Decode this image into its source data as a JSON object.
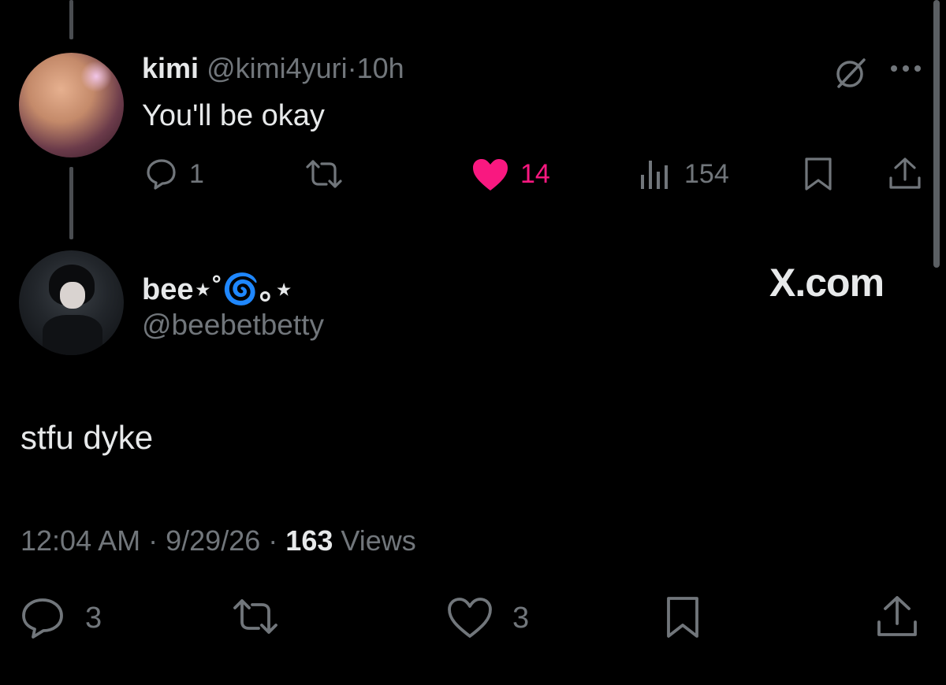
{
  "reply_tweet": {
    "display_name": "kimi",
    "handle": "@kimi4yuri",
    "separator": "·",
    "time": "10h",
    "text": "You'll be okay",
    "replies": "1",
    "likes": "14",
    "views": "154",
    "like_color": "#f91880"
  },
  "main_tweet": {
    "display_name": "bee⋆˚🌀｡⋆",
    "handle": "@beebetbetty",
    "text": "stfu dyke",
    "time": "12:04 AM",
    "date": "9/29/26",
    "views_count": "163",
    "views_label": "Views",
    "replies": "3",
    "likes": "3"
  },
  "watermark": "X.com",
  "icons": [
    "grok-slash-icon",
    "more-icon",
    "reply-icon",
    "retweet-icon",
    "heart-icon",
    "views-icon",
    "bookmark-icon",
    "share-icon"
  ]
}
